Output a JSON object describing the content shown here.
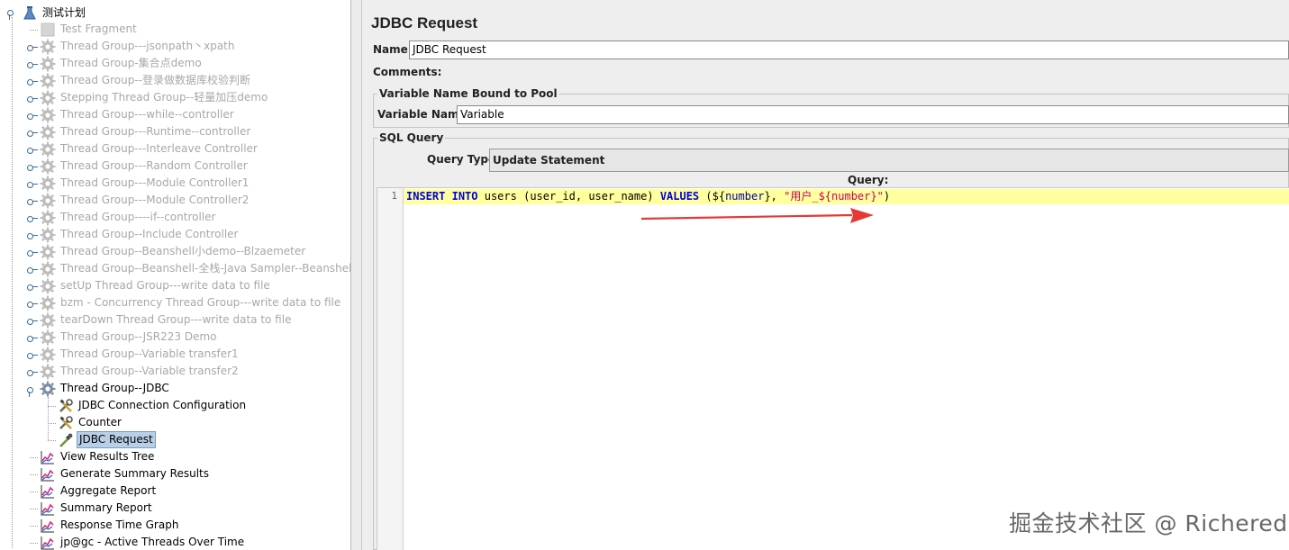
{
  "tree": {
    "root": {
      "label": "测试计划",
      "icon": "test-plan-icon"
    },
    "items": [
      {
        "label": "Test Fragment",
        "disabled": true,
        "icon": "fragment-icon"
      },
      {
        "label": "Thread Group---jsonpath丶xpath",
        "disabled": true,
        "icon": "gear-icon"
      },
      {
        "label": "Thread Group-集合点demo",
        "disabled": true,
        "icon": "gear-icon"
      },
      {
        "label": "Thread Group--登录做数据库校验判断",
        "disabled": true,
        "icon": "gear-icon"
      },
      {
        "label": "Stepping Thread Group--轻量加压demo",
        "disabled": true,
        "icon": "gear-icon"
      },
      {
        "label": "Thread Group---while--controller",
        "disabled": true,
        "icon": "gear-icon"
      },
      {
        "label": "Thread Group---Runtime--controller",
        "disabled": true,
        "icon": "gear-icon"
      },
      {
        "label": "Thread Group---Interleave Controller",
        "disabled": true,
        "icon": "gear-icon"
      },
      {
        "label": "Thread Group---Random Controller",
        "disabled": true,
        "icon": "gear-icon"
      },
      {
        "label": "Thread Group---Module Controller1",
        "disabled": true,
        "icon": "gear-icon"
      },
      {
        "label": "Thread Group---Module Controller2",
        "disabled": true,
        "icon": "gear-icon"
      },
      {
        "label": "Thread Group----if--controller",
        "disabled": true,
        "icon": "gear-icon"
      },
      {
        "label": "Thread Group--Include Controller",
        "disabled": true,
        "icon": "gear-icon"
      },
      {
        "label": "Thread Group--Beanshell小demo--Blzaemeter",
        "disabled": true,
        "icon": "gear-icon"
      },
      {
        "label": "Thread Group--Beanshell-全栈-Java Sampler--Beanshell",
        "disabled": true,
        "icon": "gear-icon"
      },
      {
        "label": "setUp Thread Group---write data to file",
        "disabled": true,
        "icon": "gear-icon"
      },
      {
        "label": "bzm - Concurrency Thread Group---write data to file",
        "disabled": true,
        "icon": "gear-icon"
      },
      {
        "label": "tearDown Thread Group---write data to file",
        "disabled": true,
        "icon": "gear-icon"
      },
      {
        "label": "Thread Group--JSR223 Demo",
        "disabled": true,
        "icon": "gear-icon"
      },
      {
        "label": "Thread Group--Variable transfer1",
        "disabled": true,
        "icon": "gear-icon"
      },
      {
        "label": "Thread Group--Variable transfer2",
        "disabled": true,
        "icon": "gear-icon"
      },
      {
        "label": "Thread Group--JDBC",
        "disabled": false,
        "icon": "gear-icon"
      }
    ],
    "jdbc_children": [
      {
        "label": "JDBC Connection Configuration",
        "icon": "wrench-screwdriver-icon"
      },
      {
        "label": "Counter",
        "icon": "wrench-screwdriver-icon"
      },
      {
        "label": "JDBC Request",
        "icon": "pipette-icon",
        "selected": true
      }
    ],
    "listeners": [
      {
        "label": "View Results Tree",
        "icon": "graph-icon"
      },
      {
        "label": "Generate Summary Results",
        "icon": "graph-icon"
      },
      {
        "label": "Aggregate Report",
        "icon": "graph-icon"
      },
      {
        "label": "Summary Report",
        "icon": "graph-icon"
      },
      {
        "label": "Response Time Graph",
        "icon": "graph-icon"
      },
      {
        "label": "jp@gc - Active Threads Over Time",
        "icon": "graph-icon"
      }
    ]
  },
  "panel": {
    "title": "JDBC Request",
    "name_label": "Name:",
    "name_value": "JDBC Request",
    "comments_label": "Comments:",
    "pool_group_title": "Variable Name Bound to Pool",
    "variable_name_label": "Variable Name:",
    "variable_name_value": "Variable",
    "sql_group_title": "SQL Query",
    "query_type_label": "Query Type:",
    "query_type_value": "Update Statement",
    "query_label": "Query:",
    "line_number": "1",
    "query_tokens": [
      {
        "t": "INSERT",
        "c": "kw"
      },
      {
        "t": " ",
        "c": "pn"
      },
      {
        "t": "INTO",
        "c": "kw"
      },
      {
        "t": " users ",
        "c": "id"
      },
      {
        "t": "(",
        "c": "pn"
      },
      {
        "t": "user_id, user_name",
        "c": "id"
      },
      {
        "t": ") ",
        "c": "pn"
      },
      {
        "t": "VALUES",
        "c": "kw"
      },
      {
        "t": " (",
        "c": "pn"
      },
      {
        "t": "${",
        "c": "pn"
      },
      {
        "t": "number",
        "c": "var"
      },
      {
        "t": "}",
        "c": "pn"
      },
      {
        "t": ", ",
        "c": "pn"
      },
      {
        "t": "\"用户_${number}\"",
        "c": "str"
      },
      {
        "t": ")",
        "c": "pn"
      }
    ]
  },
  "annotation": {
    "arrow_color": "#e53935"
  },
  "watermark": "掘金技术社区 @ Richered"
}
